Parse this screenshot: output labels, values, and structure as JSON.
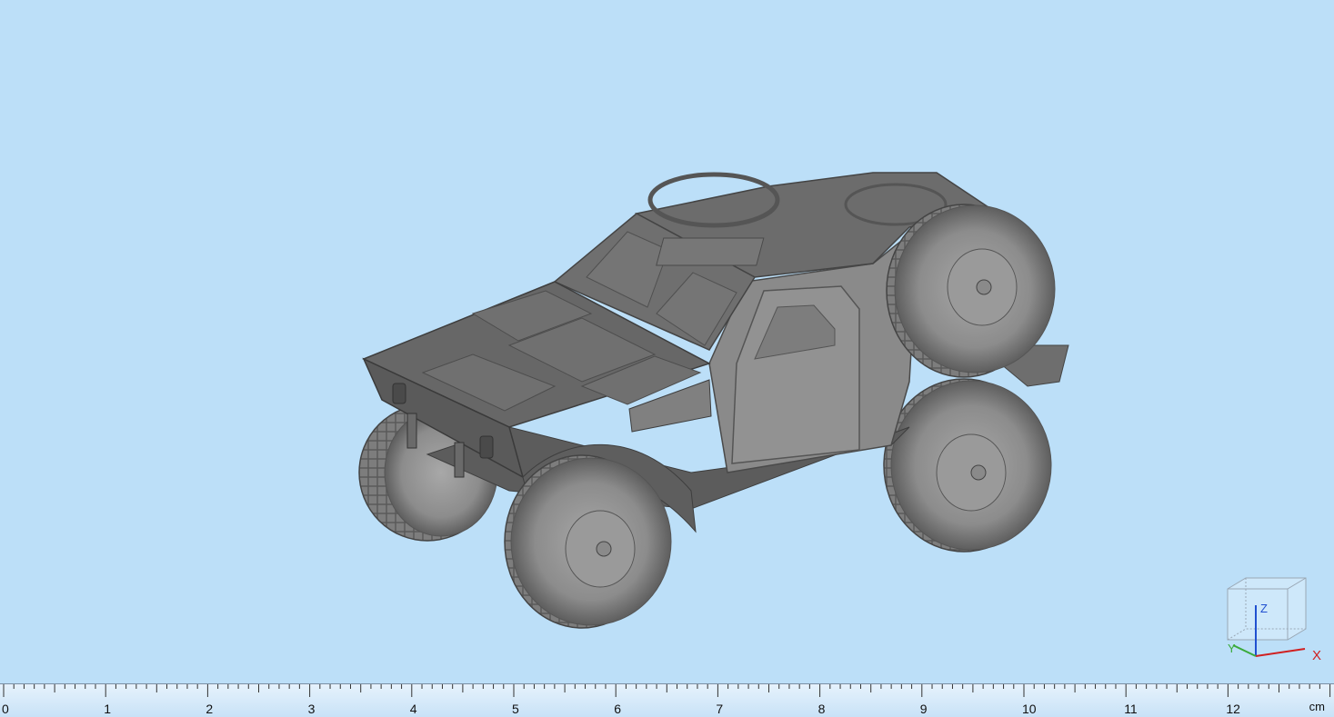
{
  "viewport": {
    "background": "#bcdff8",
    "model_color": "#7a7a7a",
    "model_name": "armored-vehicle"
  },
  "axes": {
    "x": "X",
    "y": "Y",
    "z": "Z"
  },
  "axis_colors": {
    "x": "#d02020",
    "y": "#3aaa3a",
    "z": "#2050d0"
  },
  "ruler": {
    "labels": [
      "0",
      "1",
      "2",
      "3",
      "4",
      "5",
      "6",
      "7",
      "8",
      "9",
      "10",
      "11",
      "12"
    ],
    "unit": "cm"
  }
}
